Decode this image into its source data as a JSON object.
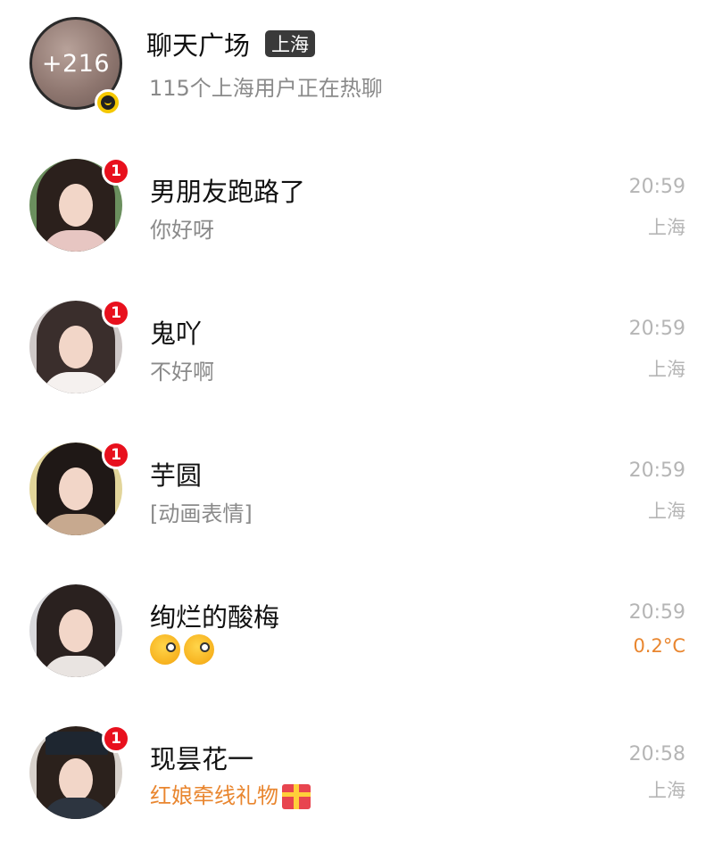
{
  "plaza": {
    "avatar_count": "+216",
    "title": "聊天广场",
    "city_tag": "上海",
    "subtitle": "115个上海用户正在热聊"
  },
  "chats": [
    {
      "name": "男朋友跑路了",
      "message": "你好呀",
      "time": "20:59",
      "location": "上海",
      "unread": "1"
    },
    {
      "name": "鬼吖",
      "message": "不好啊",
      "time": "20:59",
      "location": "上海",
      "unread": "1"
    },
    {
      "name": "芋圆",
      "message": "[动画表情]",
      "time": "20:59",
      "location": "上海",
      "unread": "1"
    },
    {
      "name": "绚烂的酸梅",
      "message": "",
      "message_emojis": [
        "wink-face-emoji",
        "wink-face-emoji"
      ],
      "time": "20:59",
      "location": "0.2°C",
      "unread": ""
    },
    {
      "name": "现昙花一",
      "message": "红娘牵线礼物",
      "message_icon": "gift-icon",
      "time": "20:58",
      "location": "上海",
      "unread": "1"
    }
  ],
  "colors": {
    "unread_badge": "#e8101d",
    "highlight_orange": "#e9862f",
    "muted_text": "#8a8a8a",
    "time_text": "#b5b5b5"
  }
}
